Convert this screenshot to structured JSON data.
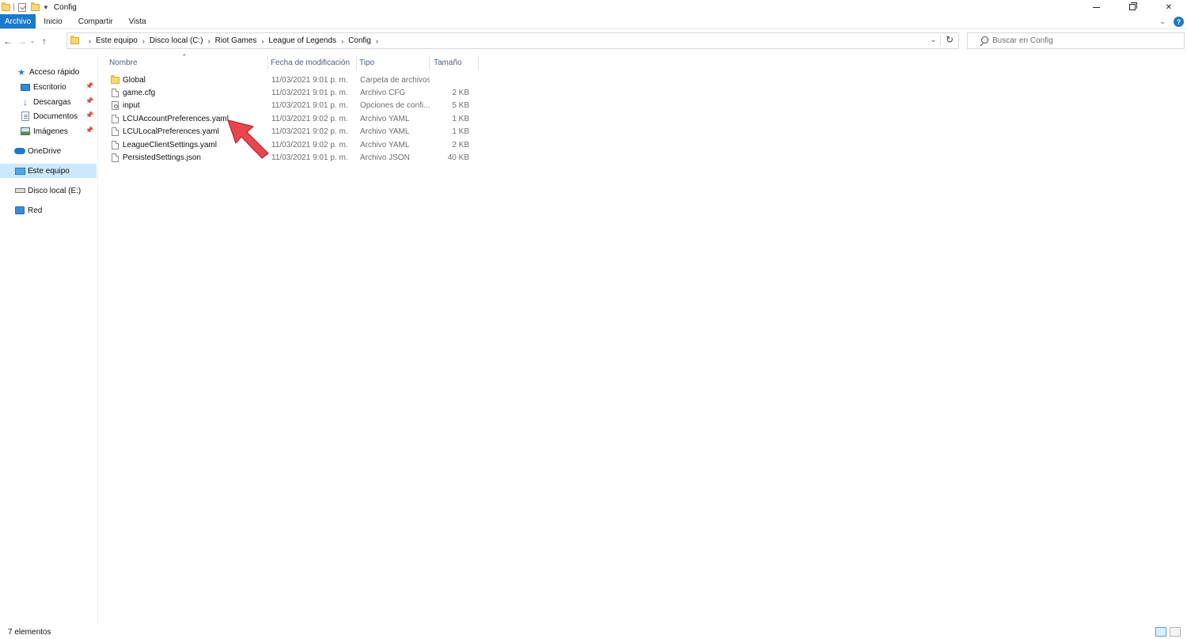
{
  "window": {
    "title": "Config"
  },
  "ribbon": {
    "tabs": [
      {
        "label": "Archivo",
        "active": true
      },
      {
        "label": "Inicio"
      },
      {
        "label": "Compartir"
      },
      {
        "label": "Vista"
      }
    ],
    "help_label": "?"
  },
  "address": {
    "crumbs": [
      "Este equipo",
      "Disco local (C:)",
      "Riot Games",
      "League of Legends",
      "Config"
    ]
  },
  "search": {
    "placeholder": "Buscar en Config",
    "value": ""
  },
  "sidebar": {
    "items": [
      {
        "label": "Acceso rápido",
        "icon": "star-icon",
        "pinned": false
      },
      {
        "label": "Escritorio",
        "icon": "desktop-icon",
        "pinned": true
      },
      {
        "label": "Descargas",
        "icon": "download-icon",
        "pinned": true
      },
      {
        "label": "Documentos",
        "icon": "documents-icon",
        "pinned": true
      },
      {
        "label": "Imágenes",
        "icon": "images-icon",
        "pinned": true
      },
      {
        "label": "OneDrive",
        "icon": "cloud-icon",
        "pinned": false
      },
      {
        "label": "Este equipo",
        "icon": "computer-icon",
        "pinned": false,
        "selected": true
      },
      {
        "label": "Disco local (E:)",
        "icon": "drive-icon",
        "pinned": false
      },
      {
        "label": "Red",
        "icon": "network-icon",
        "pinned": false
      }
    ]
  },
  "columns": {
    "name": "Nombre",
    "date": "Fecha de modificación",
    "type": "Tipo",
    "size": "Tamaño"
  },
  "files": [
    {
      "name": "Global",
      "date": "11/03/2021 9:01 p. m.",
      "type": "Carpeta de archivos",
      "size": "",
      "icon": "folder-icon"
    },
    {
      "name": "game.cfg",
      "date": "11/03/2021 9:01 p. m.",
      "type": "Archivo CFG",
      "size": "2 KB",
      "icon": "file-icon"
    },
    {
      "name": "input",
      "date": "11/03/2021 9:01 p. m.",
      "type": "Opciones de confi...",
      "size": "5 KB",
      "icon": "settings-file-icon"
    },
    {
      "name": "LCUAccountPreferences.yaml",
      "date": "11/03/2021 9:02 p. m.",
      "type": "Archivo YAML",
      "size": "1 KB",
      "icon": "file-icon"
    },
    {
      "name": "LCULocalPreferences.yaml",
      "date": "11/03/2021 9:02 p. m.",
      "type": "Archivo YAML",
      "size": "1 KB",
      "icon": "file-icon"
    },
    {
      "name": "LeagueClientSettings.yaml",
      "date": "11/03/2021 9:02 p. m.",
      "type": "Archivo YAML",
      "size": "2 KB",
      "icon": "file-icon"
    },
    {
      "name": "PersistedSettings.json",
      "date": "11/03/2021 9:01 p. m.",
      "type": "Archivo JSON",
      "size": "40 KB",
      "icon": "file-icon"
    }
  ],
  "status": {
    "text": "7 elementos"
  },
  "colors": {
    "accent": "#1979ca",
    "selection": "#cce8ff",
    "annotation_arrow": "#e8454e"
  }
}
